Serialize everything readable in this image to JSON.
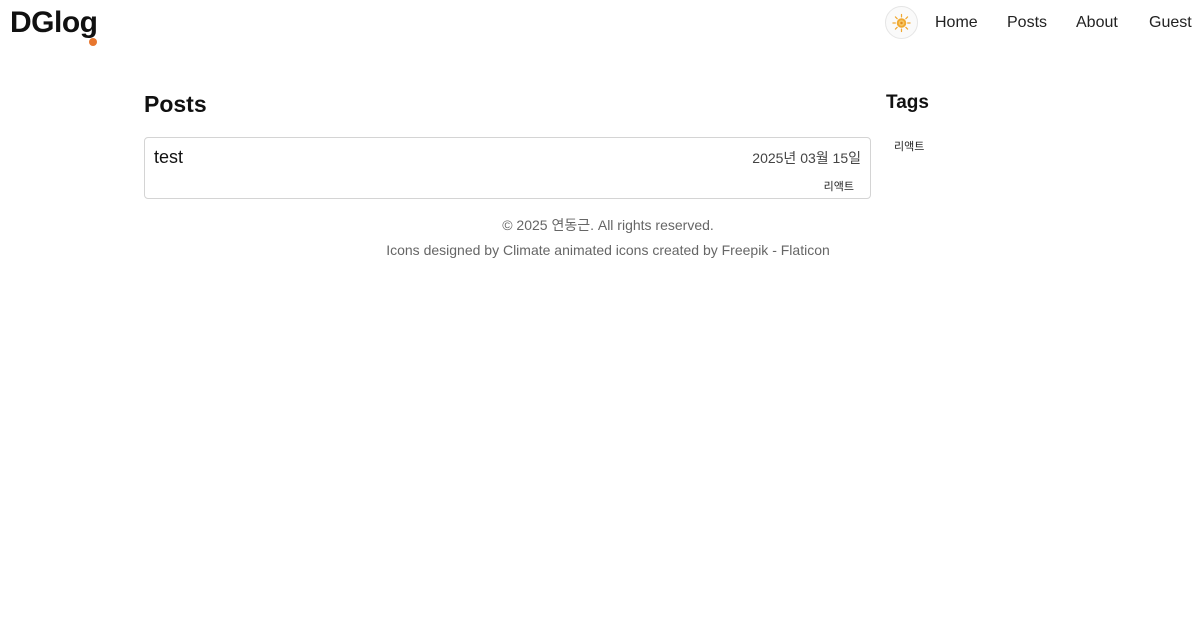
{
  "header": {
    "logo_text": "DGlog",
    "theme_icon": "sun-icon",
    "nav": {
      "home": "Home",
      "posts": "Posts",
      "about": "About",
      "guest": "Guest"
    }
  },
  "colors": {
    "accent": "#e8772e",
    "sun": "#f0a830",
    "card_border": "#d4d4d4",
    "footer_text": "#666666"
  },
  "main": {
    "title": "Posts",
    "posts": [
      {
        "title": "test",
        "date": "2025년 03월 15일",
        "tag": "리액트"
      }
    ]
  },
  "sidebar": {
    "title": "Tags",
    "tags": [
      "리액트"
    ]
  },
  "footer": {
    "copyright": "© 2025 연동근. All rights reserved.",
    "credit": "Icons designed by Climate animated icons created by Freepik - Flaticon"
  }
}
